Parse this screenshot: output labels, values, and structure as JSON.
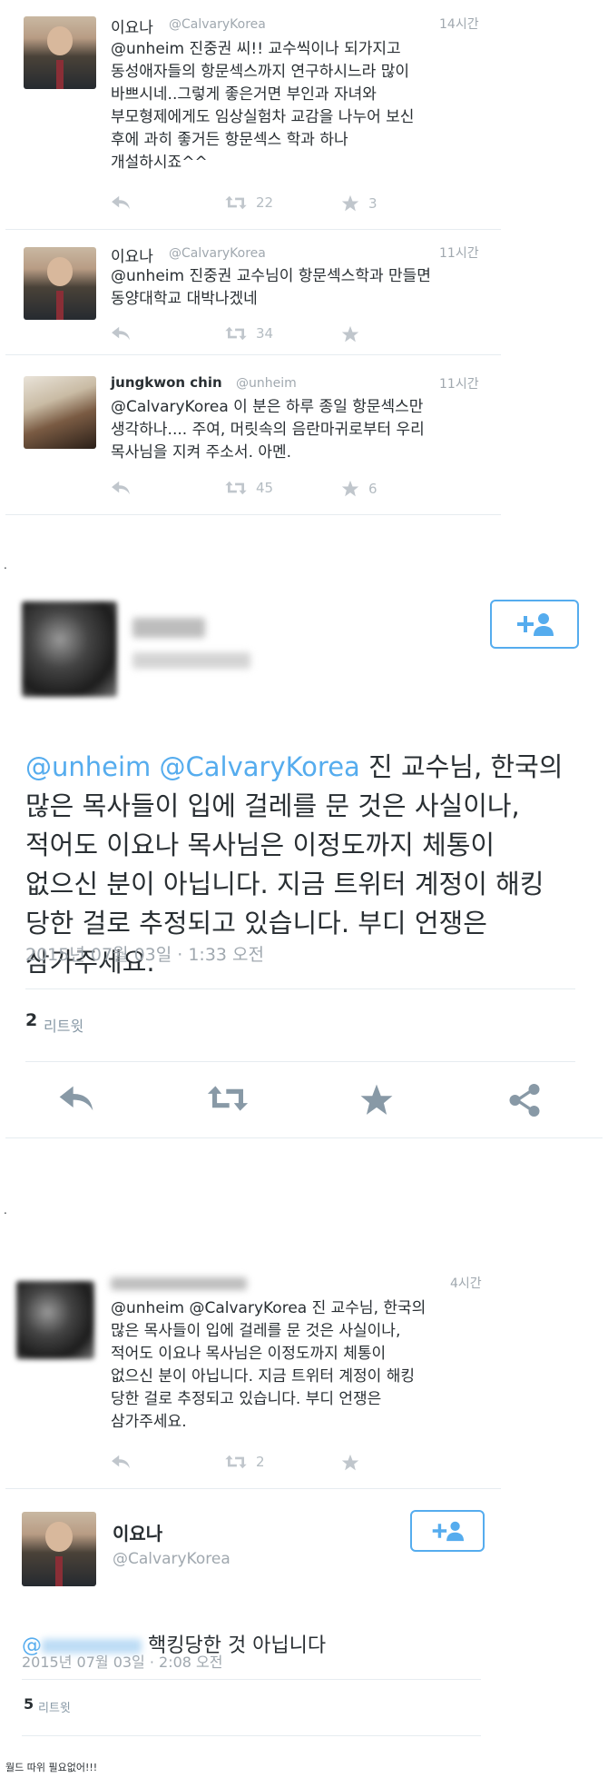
{
  "thread1": {
    "tweets": [
      {
        "name": "이요나",
        "handle": "@CalvaryKorea",
        "time": "14시간",
        "text": "@unheim 진중권 씨!! 교수씩이나 되가지고\n동성애자들의 항문섹스까지 연구하시느라 많이\n바쁘시네..그렇게 좋은거면 부인과 자녀와\n부모형제에게도 임상실험차 교감을 나누어 보신\n후에 과히 좋거든 항문섹스 학과 하나\n개설하시죠^^",
        "retweets": "22",
        "favorites": "3"
      },
      {
        "name": "이요나",
        "handle": "@CalvaryKorea",
        "time": "11시간",
        "text": "@unheim 진중권 교수님이 항문섹스학과 만들면\n동양대학교 대박나겠네",
        "retweets": "34",
        "favorites": ""
      },
      {
        "name": "jungkwon chin",
        "handle": "@unheim",
        "time": "11시간",
        "text": "@CalvaryKorea 이 분은 하루 종일 항문섹스만\n생각하나....  주여, 머릿속의 음란마귀로부터 우리\n목사님을 지켜 주소서. 아멘.",
        "retweets": "45",
        "favorites": "6"
      }
    ]
  },
  "detail1": {
    "mention1": "@unheim",
    "mention2": "@CalvaryKorea",
    "text_line1": " 진 교수님, 한국의",
    "text_rest": "많은 목사들이 입에 걸레를 문 것은 사실이나,\n적어도 이요나 목사님은 이정도까지 체통이\n없으신 분이 아닙니다. 지금 트위터 계정이 해킹\n당한 걸로 추정되고 있습니다. 부디 언쟁은\n삼가주세요.",
    "timestamp": "2015년 07월 03일 · 1:33 오전",
    "retweet_count": "2",
    "retweet_label": "리트윗"
  },
  "thread2": {
    "time": "4시간",
    "text": "@unheim @CalvaryKorea 진 교수님, 한국의\n많은 목사들이 입에 걸레를 문 것은 사실이나,\n적어도 이요나 목사님은 이정도까지 체통이\n없으신 분이 아닙니다. 지금 트위터 계정이 해킹\n당한 걸로 추정되고 있습니다. 부디 언쟁은\n삼가주세요.",
    "retweets": "2"
  },
  "detail2": {
    "name": "이요나",
    "handle": "@CalvaryKorea",
    "mention_prefix": "@",
    "text": " 핵킹당한 것 아닙니다",
    "timestamp": "2015년 07월 03일 · 2:08 오전",
    "retweet_count": "5",
    "retweet_label": "리트윗"
  },
  "caption": "월드 따위 필요없어!!!",
  "separator_dot": ".",
  "colors": {
    "accent": "#55acee",
    "text": "#292f33",
    "muted": "#a0a8af",
    "icon": "#c0c6cc"
  }
}
